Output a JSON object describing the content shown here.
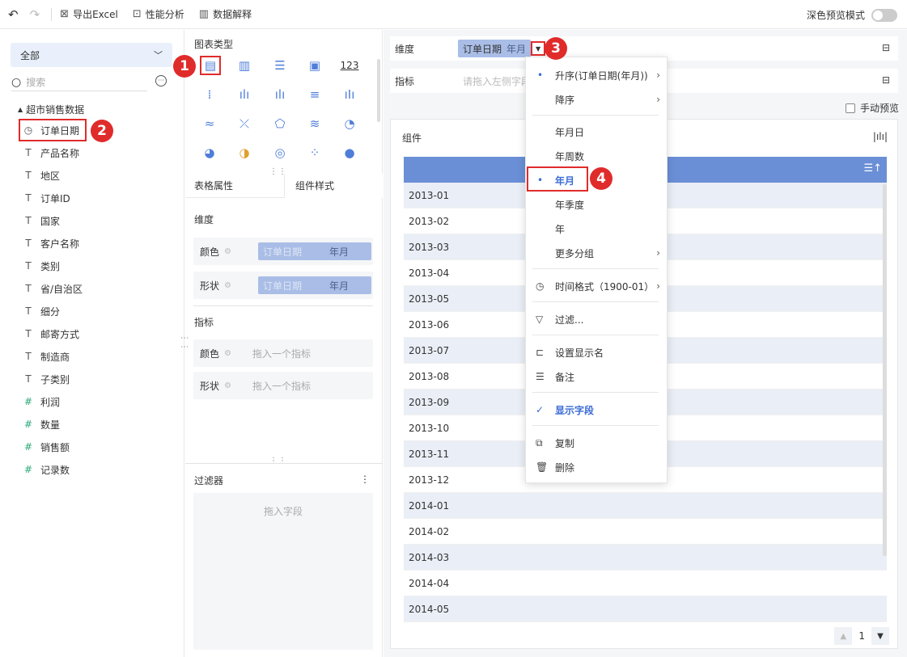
{
  "toolbar": {
    "undo_icon": "undo-icon",
    "redo_icon": "redo-icon",
    "export_label": "导出Excel",
    "perf_label": "性能分析",
    "explain_label": "数据解释",
    "dark_label": "深色预览模式"
  },
  "left": {
    "select_value": "全部",
    "search_placeholder": "搜索",
    "tree_root": "超市销售数据",
    "fields": [
      {
        "icon": "clock",
        "label": "订单日期"
      },
      {
        "icon": "T",
        "label": "产品名称"
      },
      {
        "icon": "T",
        "label": "地区"
      },
      {
        "icon": "T",
        "label": "订单ID"
      },
      {
        "icon": "T",
        "label": "国家"
      },
      {
        "icon": "T",
        "label": "客户名称"
      },
      {
        "icon": "T",
        "label": "类别"
      },
      {
        "icon": "T",
        "label": "省/自治区"
      },
      {
        "icon": "T",
        "label": "细分"
      },
      {
        "icon": "T",
        "label": "邮寄方式"
      },
      {
        "icon": "T",
        "label": "制造商"
      },
      {
        "icon": "T",
        "label": "子类别"
      },
      {
        "icon": "#",
        "label": "利润"
      },
      {
        "icon": "#",
        "label": "数量"
      },
      {
        "icon": "#",
        "label": "销售额"
      },
      {
        "icon": "#*",
        "label": "记录数"
      }
    ]
  },
  "middle": {
    "chart_type_title": "图表类型",
    "chart_type_123": "123",
    "tab_table": "表格属性",
    "tab_style": "组件样式",
    "dim_title": "维度",
    "color_label": "颜色",
    "shape_label": "形状",
    "pill_field": "订单日期",
    "pill_value": "年月",
    "metric_title": "指标",
    "metric_placeholder": "拖入一个指标",
    "filter_title": "过滤器",
    "filter_placeholder": "拖入字段"
  },
  "right": {
    "dim_label": "维度",
    "dim_chip_field": "订单日期",
    "dim_chip_value": "年月",
    "metric_label": "指标",
    "metric_placeholder": "请拖入左侧字段",
    "manual_preview": "手动预览",
    "card_title": "组件",
    "rows": [
      "2013-01",
      "2013-02",
      "2013-03",
      "2013-04",
      "2013-05",
      "2013-06",
      "2013-07",
      "2013-08",
      "2013-09",
      "2013-10",
      "2013-11",
      "2013-12",
      "2014-01",
      "2014-02",
      "2014-03",
      "2014-04",
      "2014-05"
    ],
    "page_number": "1"
  },
  "menu": {
    "asc": "升序(订单日期(年月))",
    "desc": "降序",
    "ymd": "年月日",
    "yw": "年周数",
    "ym": "年月",
    "yq": "年季度",
    "y": "年",
    "more_group": "更多分组",
    "time_format": "时间格式（1900-01）",
    "filter": "过滤...",
    "display_name": "设置显示名",
    "note": "备注",
    "show_field": "显示字段",
    "copy": "复制",
    "delete": "删除"
  },
  "badges": [
    "1",
    "2",
    "3",
    "4"
  ],
  "colors": {
    "accent": "#3a6bd6",
    "header": "#6b8fd6",
    "highlight": "#e02b2b",
    "chip": "#a9bde6"
  }
}
